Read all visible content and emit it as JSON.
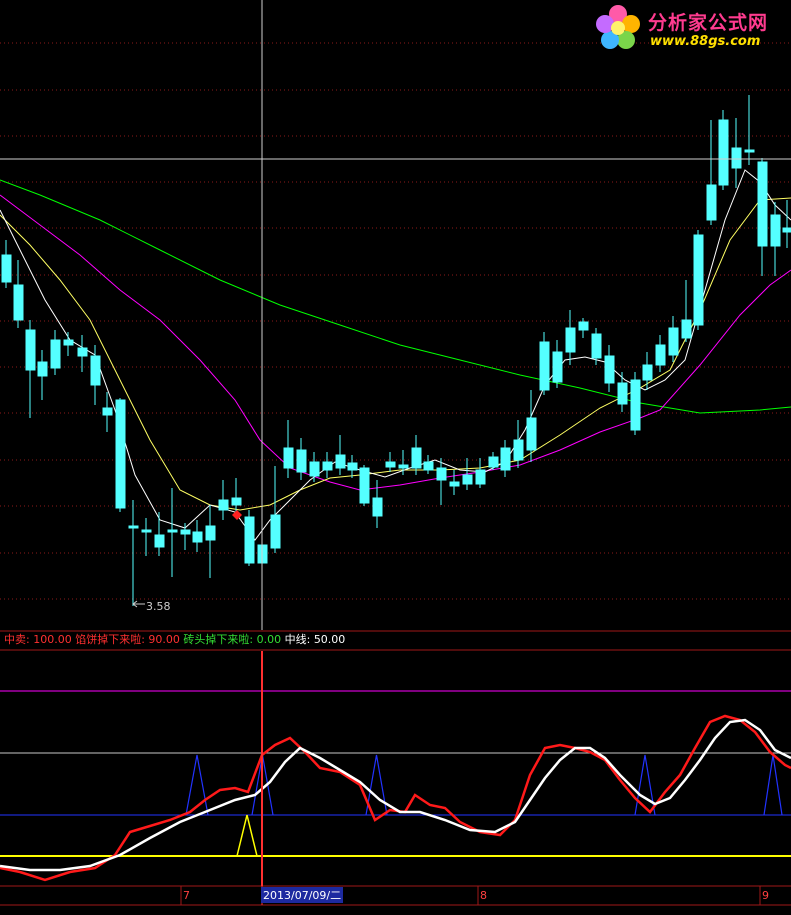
{
  "logo": {
    "title": "分析家公式网",
    "url": "www.88gs.com"
  },
  "price_chart": {
    "low_marker": "3.58"
  },
  "indicator_legend": [
    {
      "name": "中卖",
      "value": "100.00",
      "color": "#ff3030"
    },
    {
      "name": "馅饼掉下来啦",
      "value": "90.00",
      "color": "#ff3030"
    },
    {
      "name": "砖头掉下来啦",
      "value": "0.00",
      "color": "#33dd33"
    },
    {
      "name": "中线",
      "value": "50.00",
      "color": "#ffffff"
    }
  ],
  "date_axis": {
    "ticks": [
      "7",
      "8",
      "9"
    ],
    "cursor_date": "2013/07/09/二"
  },
  "colors": {
    "background": "#000000",
    "up_candle": "#ff3232",
    "down_candle": "#54ffff",
    "ma_short": "#ffffff",
    "ma_mid": "#ffff64",
    "ma_long": "#ff00ff",
    "ma_longest": "#00ff00",
    "grid": "#8b1a1a",
    "cursor": "#cfcfcf"
  }
}
